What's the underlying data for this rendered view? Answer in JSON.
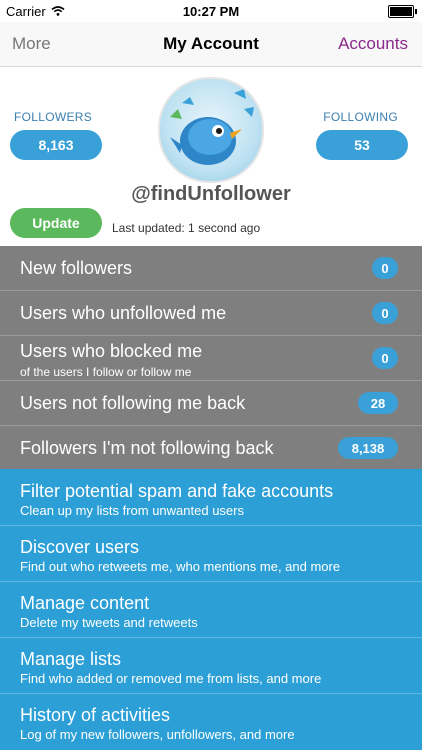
{
  "status": {
    "carrier": "Carrier",
    "time": "10:27 PM"
  },
  "nav": {
    "left": "More",
    "title": "My Account",
    "right": "Accounts"
  },
  "profile": {
    "followers_label": "FOLLOWERS",
    "followers_count": "8,163",
    "following_label": "FOLLOWING",
    "following_count": "53",
    "username": "@findUnfollower",
    "update_label": "Update",
    "last_updated": "Last updated: 1 second ago"
  },
  "stats_rows": [
    {
      "label": "New followers",
      "badge": "0"
    },
    {
      "label": "Users who unfollowed me",
      "badge": "0"
    },
    {
      "label": "Users who blocked me",
      "sublabel": "of the users I follow or follow me",
      "badge": "0"
    },
    {
      "label": "Users not following me back",
      "badge": "28"
    },
    {
      "label": "Followers I'm not following back",
      "badge": "8,138"
    }
  ],
  "menu": [
    {
      "title": "Filter potential spam and fake accounts",
      "desc": "Clean up my lists from unwanted users"
    },
    {
      "title": "Discover users",
      "desc": "Find out who retweets me, who mentions me, and more"
    },
    {
      "title": "Manage content",
      "desc": "Delete my tweets and retweets"
    },
    {
      "title": "Manage lists",
      "desc": "Find who added or removed me from lists, and more"
    },
    {
      "title": "History of activities",
      "desc": "Log of my new followers, unfollowers, and more"
    }
  ],
  "icons": {
    "wifi": "wifi-icon",
    "battery": "battery-icon",
    "avatar": "bird-avatar"
  },
  "colors": {
    "accent_blue": "#2b9fd6",
    "badge_blue": "#3aa1d8",
    "gray": "#7f7f7f",
    "update_green": "#5cb85c",
    "nav_accent": "#8a2a8c"
  }
}
